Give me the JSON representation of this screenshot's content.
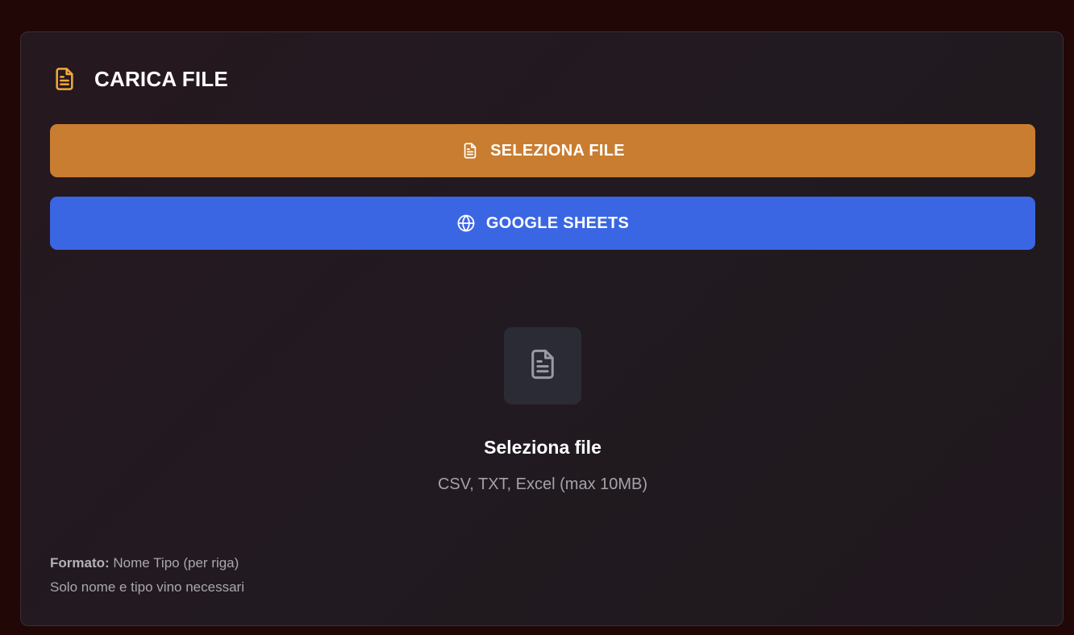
{
  "header": {
    "title": "CARICA FILE",
    "icon": "document-icon",
    "icon_color": "#f0a93b"
  },
  "buttons": {
    "select_file": {
      "label": "SELEZIONA FILE",
      "icon": "document-icon",
      "color": "#c97d30"
    },
    "google_sheets": {
      "label": "GOOGLE SHEETS",
      "icon": "globe-icon",
      "color": "#3a66e3"
    }
  },
  "dropzone": {
    "icon": "document-icon",
    "title": "Seleziona file",
    "subtitle": "CSV, TXT, Excel (max 10MB)"
  },
  "notes": {
    "format_label": "Formato:",
    "format_value": "Nome Tipo (per riga)",
    "requirement": "Solo nome e tipo vino necessari"
  }
}
